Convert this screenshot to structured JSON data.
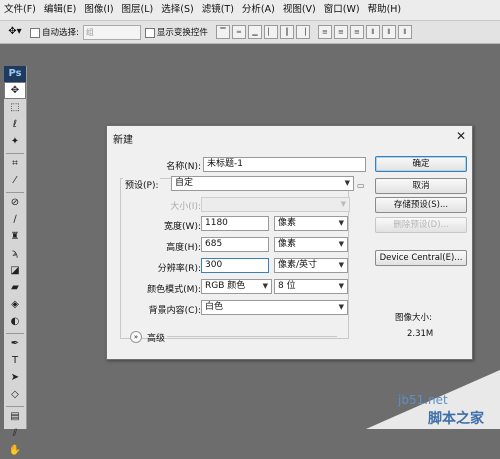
{
  "menubar": [
    "文件(F)",
    "编辑(E)",
    "图像(I)",
    "图层(L)",
    "选择(S)",
    "滤镜(T)",
    "分析(A)",
    "视图(V)",
    "窗口(W)",
    "帮助(H)"
  ],
  "options": {
    "auto_select_label": "自动选择:",
    "auto_select_value": "组",
    "show_transform_label": "显示变换控件"
  },
  "toolbox": {
    "logo": "Ps",
    "tools": [
      "move-tool",
      "marquee-tool",
      "lasso-tool",
      "magic-wand-tool",
      "crop-tool",
      "eyedropper-tool",
      "healing-brush-tool",
      "brush-tool",
      "clone-stamp-tool",
      "history-brush-tool",
      "eraser-tool",
      "gradient-tool",
      "blur-tool",
      "dodge-tool",
      "pen-tool",
      "type-tool",
      "path-selection-tool",
      "shape-tool",
      "notes-tool",
      "hand-tool",
      "zoom-tool"
    ]
  },
  "dialog": {
    "title": "新建",
    "name_label": "名称(N):",
    "name_value": "未标题-1",
    "preset_label": "预设(P):",
    "preset_value": "自定",
    "size_label": "大小(I):",
    "width_label": "宽度(W):",
    "width_value": "1180",
    "width_unit": "像素",
    "height_label": "高度(H):",
    "height_value": "685",
    "height_unit": "像素",
    "resolution_label": "分辨率(R):",
    "resolution_value": "300",
    "resolution_unit": "像素/英寸",
    "color_mode_label": "颜色模式(M):",
    "color_mode_value": "RGB 颜色",
    "bit_depth_value": "8 位",
    "background_label": "背景内容(C):",
    "background_value": "白色",
    "advanced_label": "高级",
    "ok_label": "确定",
    "cancel_label": "取消",
    "save_preset_label": "存储预设(S)...",
    "delete_preset_label": "删除预设(D)...",
    "device_central_label": "Device Central(E)...",
    "image_size_label": "图像大小:",
    "image_size_value": "2.31M"
  },
  "watermark": {
    "site": "jb51.net",
    "brand": "脚本之家"
  }
}
